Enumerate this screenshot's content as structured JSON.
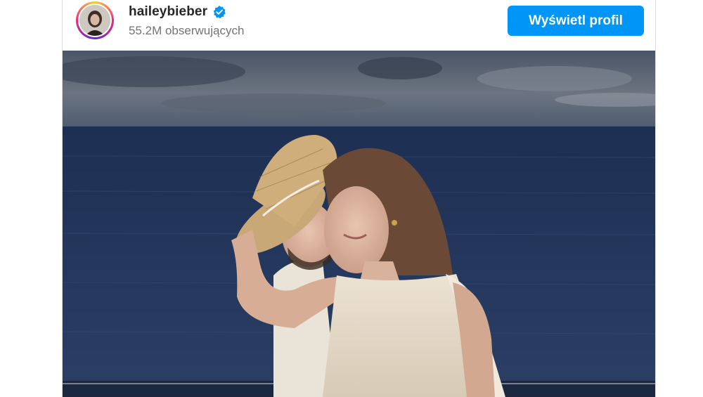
{
  "post": {
    "username": "haileybieber",
    "followers": "55.2M obserwujących",
    "view_profile_label": "Wyświetl profil",
    "verified_icon": "verified-badge-icon",
    "avatar_icon": "profile-avatar",
    "image_alt": "Couple on a yacht at dusk, man in straw hat, woman in cream dress, ocean and cloudy sky behind"
  },
  "colors": {
    "accent": "#0095f6",
    "username": "#262626",
    "secondary_text": "#737373"
  }
}
